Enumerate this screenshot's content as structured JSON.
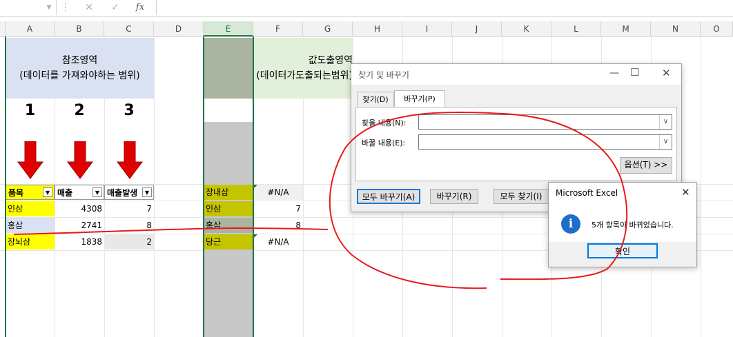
{
  "formula_bar": {
    "fx_label": "fx"
  },
  "columns": [
    "A",
    "B",
    "C",
    "D",
    "E",
    "F",
    "G",
    "H",
    "I",
    "J",
    "K",
    "L",
    "M",
    "N",
    "O"
  ],
  "ref_area": {
    "title": "참조영역",
    "subtitle": "(데이터를 가져와야하는 범위)"
  },
  "out_area": {
    "title": "값도출영역",
    "subtitle": "(데이터가도출되는범위)"
  },
  "step_numbers": [
    "1",
    "2",
    "3"
  ],
  "table_headers": [
    "품목",
    "매출",
    "매출발생"
  ],
  "table_rows": [
    {
      "item": "인삼",
      "sales": "4308",
      "count": "7"
    },
    {
      "item": "홍삼",
      "sales": "2741",
      "count": "8"
    },
    {
      "item": "장뇌삼",
      "sales": "1838",
      "count": "2"
    }
  ],
  "out_rows": [
    {
      "item": "장내삼",
      "value": "#N/A"
    },
    {
      "item": "인삼",
      "value": "7"
    },
    {
      "item": "홍삼",
      "value": "8"
    },
    {
      "item": "당근",
      "value": "#N/A"
    }
  ],
  "find_dialog": {
    "title": "찾기 및 바꾸기",
    "tab_find": "찾기(D)",
    "tab_replace": "바꾸기(P)",
    "find_label": "찾을 내용(N):",
    "replace_label": "바꿀 내용(E):",
    "options_button": "옵션(T) >>",
    "replace_all_button": "모두 바꾸기(A)",
    "replace_button": "바꾸기(R)",
    "find_all_button": "모두 찾기(I)"
  },
  "msgbox": {
    "title": "Microsoft Excel",
    "message": "5개 항목이 바뀌었습니다.",
    "ok_button": "확인"
  },
  "colors": {
    "ref_bg": "#d9e1f2",
    "out_bg": "#e2efda",
    "yellow": "#ffff00",
    "olive": "#c4c400",
    "accent": "#217346",
    "annotation": "#e8191b"
  }
}
